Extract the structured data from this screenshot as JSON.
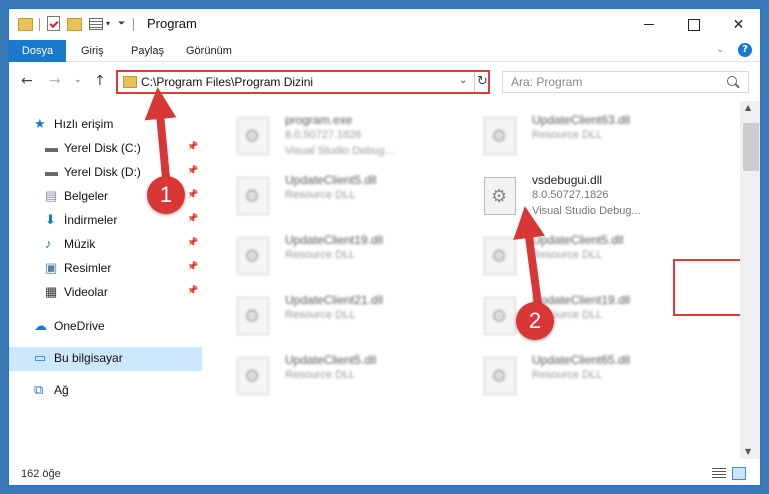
{
  "window": {
    "title": "Program"
  },
  "ribbon": {
    "tabs": [
      "Dosya",
      "Giriş",
      "Paylaş",
      "Görünüm"
    ],
    "help": "?"
  },
  "navigation": {
    "address": "C:\\Program Files\\Program Dizini",
    "search_placeholder": "Ara: Program"
  },
  "sidebar": {
    "items": [
      {
        "label": "Hızlı erişim",
        "icon": "star-icon",
        "pinned": false
      },
      {
        "label": "Yerel Disk (C:)",
        "icon": "drive-icon",
        "pinned": true
      },
      {
        "label": "Yerel Disk (D:)",
        "icon": "drive-icon",
        "pinned": true
      },
      {
        "label": "Belgeler",
        "icon": "documents-icon",
        "pinned": true
      },
      {
        "label": "İndirmeler",
        "icon": "download-icon",
        "pinned": true
      },
      {
        "label": "Müzik",
        "icon": "music-icon",
        "pinned": true
      },
      {
        "label": "Resimler",
        "icon": "pictures-icon",
        "pinned": true
      },
      {
        "label": "Videolar",
        "icon": "videos-icon",
        "pinned": true
      },
      {
        "label": "OneDrive",
        "icon": "onedrive-icon",
        "pinned": false
      },
      {
        "label": "Bu bilgisayar",
        "icon": "this-pc-icon",
        "pinned": false,
        "selected": true
      },
      {
        "label": "Ağ",
        "icon": "network-icon",
        "pinned": false
      }
    ]
  },
  "files": [
    {
      "name": "program.exe",
      "line2": "8.0.50727.1826",
      "line3": "Visual Studio Debug...",
      "icon": "exe-icon"
    },
    {
      "name": "UpdateClient63.dll",
      "line2": "Resource DLL",
      "line3": "",
      "icon": "dll-icon"
    },
    {
      "name": "UpdateClient5.dll",
      "line2": "Resource DLL",
      "line3": "",
      "icon": "dll-icon"
    },
    {
      "name": "vsdebugui.dll",
      "line2": "8.0.50727.1826",
      "line3": "Visual Studio Debug...",
      "icon": "dll-icon",
      "highlighted": true
    },
    {
      "name": "UpdateClient19.dll",
      "line2": "Resource DLL",
      "line3": "",
      "icon": "dll-icon"
    },
    {
      "name": "UpdateClient5.dll",
      "line2": "Resource DLL",
      "line3": "",
      "icon": "dll-icon"
    },
    {
      "name": "UpdateClient21.dll",
      "line2": "Resource DLL",
      "line3": "",
      "icon": "dll-icon"
    },
    {
      "name": "UpdateClient19.dll",
      "line2": "Resource DLL",
      "line3": "",
      "icon": "dll-icon"
    },
    {
      "name": "UpdateClient5.dll",
      "line2": "Resource DLL",
      "line3": "",
      "icon": "dll-icon"
    },
    {
      "name": "UpdateClient65.dll",
      "line2": "Resource DLL",
      "line3": "",
      "icon": "dll-icon"
    }
  ],
  "status": {
    "count": "162 öğe"
  },
  "annotations": {
    "marker_1": "1",
    "marker_2": "2",
    "color": "#d93636"
  }
}
